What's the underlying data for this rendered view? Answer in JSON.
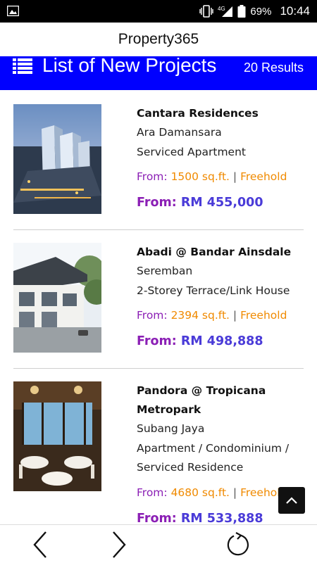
{
  "status_bar": {
    "network": "4G",
    "battery_percent": "69%",
    "time": "10:44",
    "icons": [
      "gallery-icon",
      "vibrate-icon",
      "signal-icon",
      "battery-icon"
    ]
  },
  "app": {
    "title": "Property365"
  },
  "header": {
    "title": "List of New Projects",
    "results": "20 Results",
    "background": "#0000ff",
    "icon": "list-icon"
  },
  "listings": [
    {
      "name": "Cantara Residences",
      "location": "Ara Damansara",
      "type": "Serviced Apartment",
      "from_label": "From:",
      "size": "1500 sq.ft.",
      "separator": "|",
      "tenure": "Freehold",
      "price_label": "From:",
      "price": "RM 455,000"
    },
    {
      "name": "Abadi @ Bandar Ainsdale",
      "location": "Seremban",
      "type": "2-Storey Terrace/Link House",
      "from_label": "From:",
      "size": "2394 sq.ft.",
      "separator": "|",
      "tenure": "Freehold",
      "price_label": "From:",
      "price": "RM 498,888"
    },
    {
      "name": "Pandora @ Tropicana Metropark",
      "location": "Subang Jaya",
      "type": "Apartment / Condominium / Serviced Residence",
      "from_label": "From:",
      "size": "4680 sq.ft.",
      "separator": "|",
      "tenure": "Freehold",
      "price_label": "From:",
      "price": "RM 533,888"
    }
  ],
  "colors": {
    "label_purple": "#8b1fb5",
    "value_orange": "#f08a00",
    "price_blue": "#4a3bd8"
  },
  "nav": {
    "back_icon": "chevron-left-icon",
    "forward_icon": "chevron-right-icon",
    "refresh_icon": "refresh-icon",
    "scroll_top_icon": "chevron-up-icon"
  }
}
